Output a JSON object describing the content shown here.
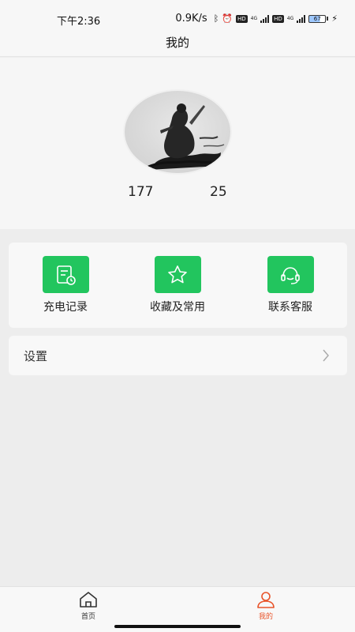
{
  "status_bar": {
    "time": "下午2:36",
    "speed": "0.9K/s",
    "network_tag_1": "HD",
    "network_tag_2": "HD",
    "gen_1": "4G",
    "gen_2": "4G",
    "battery": "67"
  },
  "header": {
    "title": "我的"
  },
  "profile": {
    "stat_left": "177",
    "stat_right": "25"
  },
  "menu": {
    "items": [
      {
        "label": "充电记录",
        "icon": "charge-record-icon"
      },
      {
        "label": "收藏及常用",
        "icon": "star-icon"
      },
      {
        "label": "联系客服",
        "icon": "headset-icon"
      }
    ]
  },
  "settings": {
    "label": "设置"
  },
  "tabbar": {
    "tabs": [
      {
        "label": "首页",
        "icon": "home-icon"
      },
      {
        "label": "我的",
        "icon": "user-icon"
      }
    ]
  },
  "colors": {
    "accent_green": "#22c55e",
    "active_tab": "#e8542a"
  }
}
